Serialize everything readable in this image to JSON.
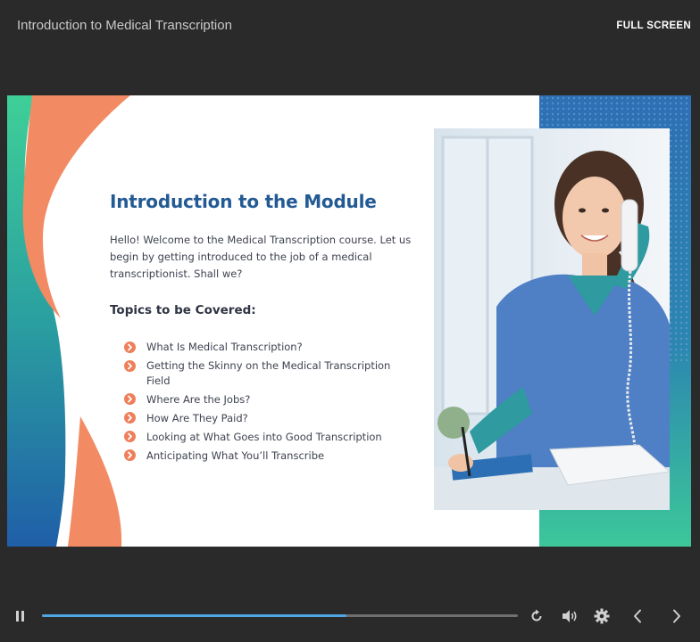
{
  "header": {
    "title": "Introduction to Medical Transcription",
    "fullscreen_label": "FULL SCREEN"
  },
  "slide": {
    "title": "Introduction to the Module",
    "intro": "Hello! Welcome to the Medical Transcription course. Let us begin by getting introduced to the job of a medical transcriptionist. Shall we?",
    "topics_heading": "Topics to be Covered:",
    "topics": [
      "What Is Medical Transcription?",
      "Getting the Skinny on the Medical Transcription Field",
      "Where Are the Jobs?",
      "How Are They Paid?",
      "Looking at What Goes into Good Transcription",
      "Anticipating What You’ll Transcribe"
    ],
    "photo_icon": "nurse-on-phone-photo",
    "bullet_icon": "chevron-right-circle-icon"
  },
  "player": {
    "progress": 0.64,
    "icons": [
      "pause-icon",
      "replay-icon",
      "volume-icon",
      "settings-gear-icon",
      "previous-slide-icon",
      "next-slide-icon"
    ]
  },
  "colors": {
    "background": "#2a2a2a",
    "title_blue": "#235a94",
    "accent_orange": "#ee7f5a",
    "accent_teal": "#3cc79a",
    "accent_blue": "#2d6fb3",
    "progress": "#4ea6e2"
  }
}
